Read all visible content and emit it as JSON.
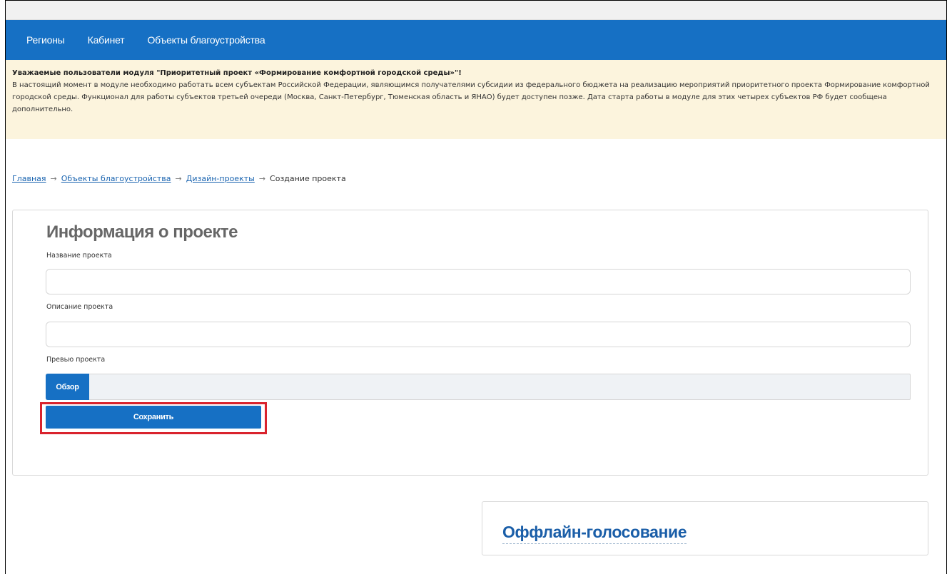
{
  "nav": {
    "items": [
      {
        "label": "Регионы"
      },
      {
        "label": "Кабинет"
      },
      {
        "label": "Объекты благоустройства"
      }
    ]
  },
  "notice": {
    "title": "Уважаемые пользователи модуля \"Приоритетный проект «Формирование комфортной городской среды»\"!",
    "body": "В настоящий момент в модуле необходимо работать всем субъектам Российской Федерации, являющимся получателями субсидии из федерального бюджета на реализацию мероприятий приоритетного проекта Формирование комфортной городской среды. Функционал для работы субъектов третьей очереди (Москва, Санкт-Петербург, Тюменская область и ЯНАО) будет доступен позже. Дата старта работы в модуле для этих четырех субъектов РФ будет сообщена дополнительно."
  },
  "breadcrumb": {
    "home": "Главная",
    "objects": "Объекты благоустройства",
    "design": "Дизайн-проекты",
    "current": "Создание проекта",
    "separator": "→"
  },
  "form": {
    "title": "Информация о проекте",
    "name_label": "Название проекта",
    "name_value": "",
    "description_label": "Описание проекта",
    "description_value": "",
    "preview_label": "Превью проекта",
    "browse_label": "Обзор",
    "save_label": "Сохранить"
  },
  "offline": {
    "title": "Оффлайн-голосование"
  },
  "colors": {
    "nav_bg": "#1670c4",
    "notice_bg": "#fcf4dd",
    "highlight": "#d9232d",
    "link": "#1a64b0"
  }
}
